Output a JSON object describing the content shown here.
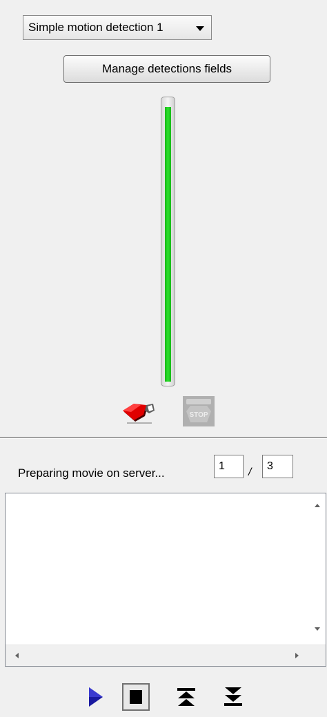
{
  "detection": {
    "selected": "Simple motion detection 1"
  },
  "manage_button": "Manage detections fields",
  "meter": {
    "level_fraction": 0.98,
    "color": "#22cc22"
  },
  "icons": {
    "record": "record-icon",
    "stop_record": "stop-sign-icon"
  },
  "status": {
    "label": "Preparing movie on server...",
    "current": "1",
    "separator": "/",
    "total": "3"
  },
  "log": {
    "text": ""
  },
  "playback": {
    "play": "play-icon",
    "stop": "stop-icon",
    "rewind": "skip-to-start-icon",
    "forward": "skip-to-end-icon"
  }
}
